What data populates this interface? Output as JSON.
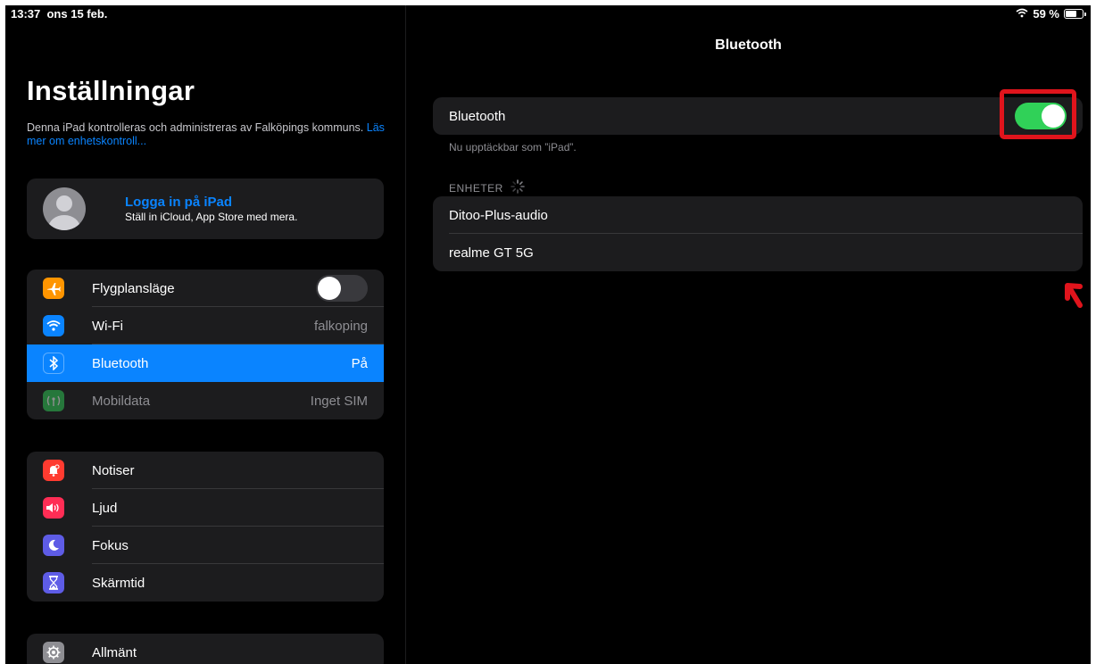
{
  "status_bar": {
    "time": "13:37",
    "date": "ons 15 feb.",
    "battery_text": "59 %",
    "battery_level": 0.59
  },
  "sidebar": {
    "title": "Inställningar",
    "managed_text": "Denna iPad kontrolleras och administreras av Falköpings kommuns.",
    "managed_link": "Läs mer om enhetskontroll...",
    "profile": {
      "title": "Logga in på iPad",
      "subtitle": "Ställ in iCloud, App Store med mera."
    },
    "group1": [
      {
        "label": "Flygplansläge",
        "icon": "airplane-icon",
        "color": "#ff9500",
        "toggle": false
      },
      {
        "label": "Wi-Fi",
        "icon": "wifi-icon",
        "color": "#0a84ff",
        "value": "falkoping"
      },
      {
        "label": "Bluetooth",
        "icon": "bluetooth-icon",
        "color": "#0a84ff",
        "value": "På",
        "selected": true
      },
      {
        "label": "Mobildata",
        "icon": "antenna-icon",
        "color": "#30d158",
        "value": "Inget SIM",
        "disabled": true
      }
    ],
    "group2": [
      {
        "label": "Notiser",
        "icon": "bell-icon",
        "color": "#ff3b30"
      },
      {
        "label": "Ljud",
        "icon": "speaker-icon",
        "color": "#ff2d55"
      },
      {
        "label": "Fokus",
        "icon": "moon-icon",
        "color": "#5e5ce6"
      },
      {
        "label": "Skärmtid",
        "icon": "hourglass-icon",
        "color": "#5e5ce6"
      }
    ],
    "group3": [
      {
        "label": "Allmänt",
        "icon": "gear-icon",
        "color": "#8e8e93"
      }
    ]
  },
  "detail": {
    "title": "Bluetooth",
    "bluetooth_label": "Bluetooth",
    "bluetooth_on": true,
    "discoverable_text": "Nu upptäckbar som ”iPad”.",
    "devices_header": "ENHETER",
    "devices": [
      "Ditoo-Plus-audio",
      "realme GT 5G"
    ]
  },
  "colors": {
    "accent": "#0a84ff",
    "toggle_on": "#30d158",
    "annotation": "#e0141c"
  }
}
